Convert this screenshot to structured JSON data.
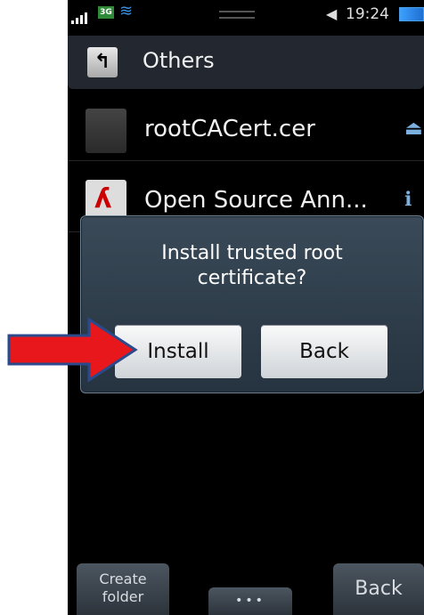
{
  "status_bar": {
    "network": "3G",
    "time": "19:24"
  },
  "folder": {
    "title": "Others",
    "up_icon": "up-arrow-icon"
  },
  "files": [
    {
      "name": "rootCACert.cer",
      "icon": "file-icon",
      "action_icon": "install-icon"
    },
    {
      "name": "Open Source Ann...",
      "icon": "pdf-icon",
      "action_icon": "info-icon"
    }
  ],
  "dialog": {
    "message_line1": "Install trusted root",
    "message_line2": "certificate?",
    "install_label": "Install",
    "back_label": "Back"
  },
  "bottom_bar": {
    "create_folder_line1": "Create",
    "create_folder_line2": "folder",
    "more_label": "•••",
    "back_label": "Back"
  },
  "annotation": {
    "arrow_color": "#e8171b",
    "arrow_outline": "#2b4a8c"
  }
}
